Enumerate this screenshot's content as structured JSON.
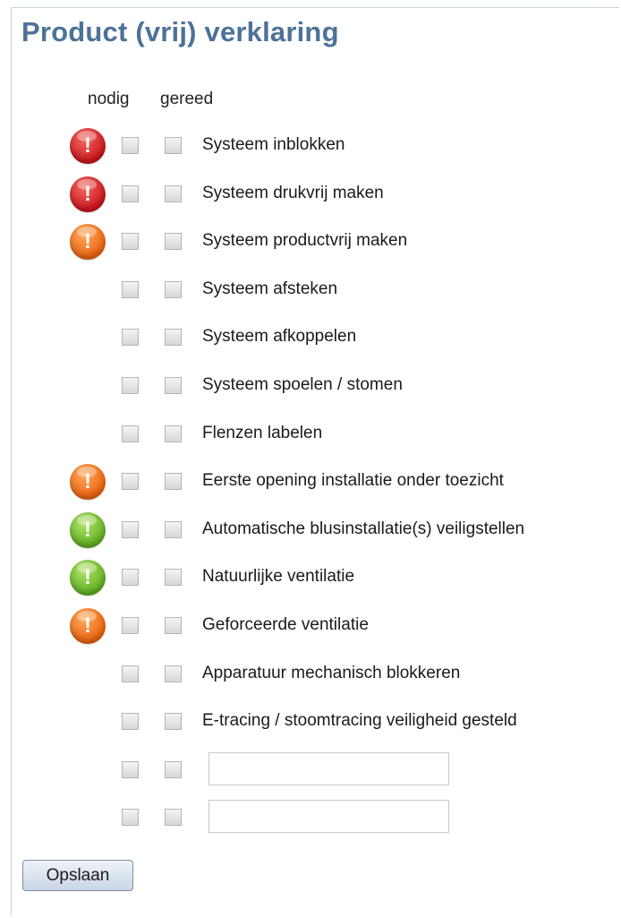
{
  "page": {
    "title": "Product (vrij) verklaring"
  },
  "columns": {
    "nodig": "nodig",
    "gereed": "gereed"
  },
  "items": [
    {
      "label": "Systeem inblokken",
      "alert": "red"
    },
    {
      "label": "Systeem drukvrij maken",
      "alert": "red"
    },
    {
      "label": "Systeem productvrij maken",
      "alert": "orange"
    },
    {
      "label": "Systeem afsteken",
      "alert": null
    },
    {
      "label": "Systeem afkoppelen",
      "alert": null
    },
    {
      "label": "Systeem spoelen / stomen",
      "alert": null
    },
    {
      "label": "Flenzen labelen",
      "alert": null
    },
    {
      "label": "Eerste opening installatie onder toezicht",
      "alert": "orange"
    },
    {
      "label": "Automatische blusinstallatie(s) veiligstellen",
      "alert": "green"
    },
    {
      "label": "Natuurlijke ventilatie",
      "alert": "green"
    },
    {
      "label": "Geforceerde ventilatie",
      "alert": "orange"
    },
    {
      "label": "Apparatuur mechanisch blokkeren",
      "alert": null
    },
    {
      "label": "E-tracing / stoomtracing veiligheid gesteld",
      "alert": null
    },
    {
      "label": null,
      "input_value": "",
      "input_placeholder": "",
      "alert": null
    },
    {
      "label": null,
      "input_value": "",
      "input_placeholder": "",
      "alert": null
    }
  ],
  "alert_glyph": "!",
  "alert_colors": {
    "red": "#d42a27",
    "orange": "#f47a1f",
    "green": "#7cc43a"
  },
  "save_button": {
    "label": "Opslaan"
  }
}
